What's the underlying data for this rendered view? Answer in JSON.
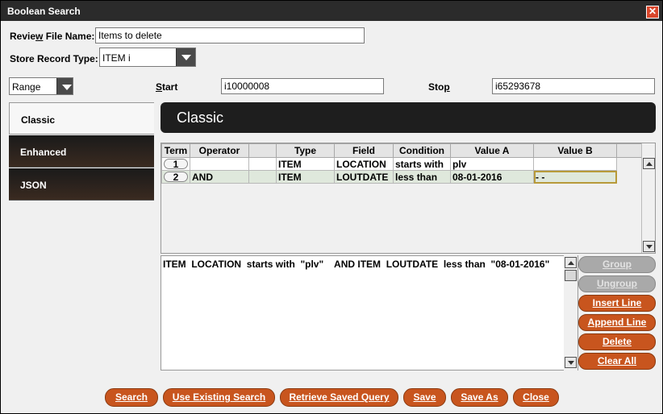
{
  "window": {
    "title": "Boolean Search",
    "close_glyph": "✕"
  },
  "form": {
    "review_label_a": "Revie",
    "review_label_ul": "w",
    "review_label_b": " File Name:",
    "review_value": "Items to delete",
    "store_label": "Store Record Type:",
    "store_value": "ITEM  i",
    "range_value": "Range",
    "start_label_ul": "S",
    "start_label_b": "tart",
    "start_value": "i10000008",
    "stop_label_a": "Sto",
    "stop_label_ul": "p",
    "stop_value": "i65293678"
  },
  "tabs": [
    {
      "label": "Classic"
    },
    {
      "label": "Enhanced"
    },
    {
      "label": "JSON"
    }
  ],
  "panel": {
    "title": "Classic"
  },
  "grid": {
    "headers": [
      "Term",
      "Operator",
      "",
      "Type",
      "Field",
      "Condition",
      "Value A",
      "Value B",
      ""
    ],
    "rows": [
      {
        "term": "1",
        "operator": "",
        "type": "ITEM",
        "field": "LOCATION",
        "condition": "starts with",
        "value_a": "plv",
        "value_b": ""
      },
      {
        "term": "2",
        "operator": "AND",
        "type": "ITEM",
        "field": "LOUTDATE",
        "condition": "less than",
        "value_a": "08-01-2016",
        "value_b": " -  -"
      }
    ]
  },
  "query": {
    "text": "ITEM  LOCATION  starts with  \"plv\"    AND ITEM  LOUTDATE  less than  \"08-01-2016\""
  },
  "side_buttons": {
    "group": "Group",
    "ungroup": "Ungroup",
    "insert_line": "Insert Line",
    "append_line": "Append Line",
    "delete": "Delete",
    "clear_all": "Clear All"
  },
  "bottom_buttons": {
    "search": "Search",
    "use_existing": "Use Existing Search",
    "retrieve": "Retrieve Saved Query",
    "save": "Save",
    "save_as": "Save As",
    "close": "Close"
  },
  "colors": {
    "accent": "#c8551e",
    "titlebar": "#2b2b2b",
    "header": "#1e1e1e",
    "close": "#d9462b"
  }
}
